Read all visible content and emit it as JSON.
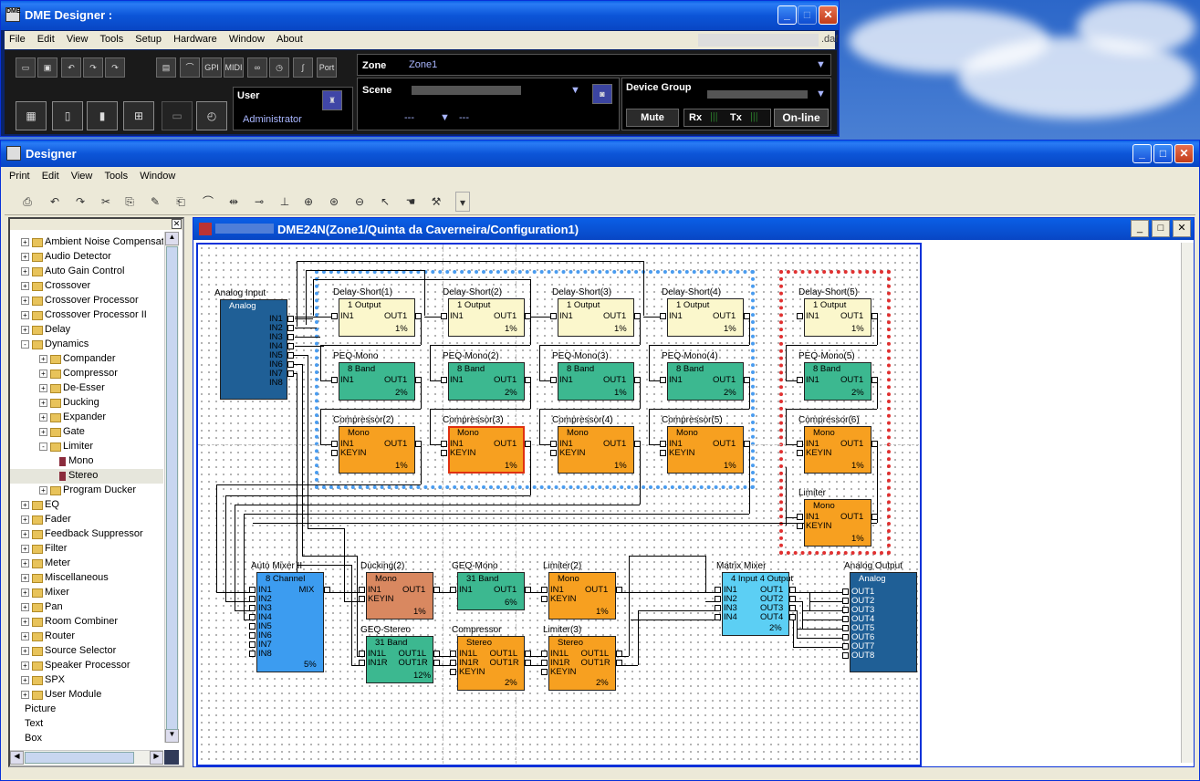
{
  "dme": {
    "title": "DME Designer :",
    "file_suffix": ".daf",
    "menu": [
      "File",
      "Edit",
      "View",
      "Tools",
      "Setup",
      "Hardware",
      "Window",
      "About"
    ],
    "toolbar_icons": [
      "open-icon",
      "save-icon",
      "undo-icon",
      "redo-icon",
      "redo2-icon",
      "meter-icon",
      "graph-icon",
      "gpi-icon",
      "midi-icon",
      "link-icon",
      "clock-icon",
      "wave-icon",
      "port-icon"
    ],
    "small_labels": {
      "gpi": "GPI",
      "midi": "MIDI",
      "port": "Port"
    },
    "user": {
      "label": "User",
      "name": "Administrator"
    },
    "zone": {
      "label": "Zone",
      "value": "Zone1"
    },
    "scene": {
      "label": "Scene",
      "num1": "---",
      "num2": "---"
    },
    "device_group": {
      "label": "Device Group"
    },
    "mute": "Mute",
    "rx": "Rx",
    "tx": "Tx",
    "online": "On-line"
  },
  "designer": {
    "title": "Designer",
    "menu": [
      "Print",
      "Edit",
      "View",
      "Tools",
      "Window"
    ]
  },
  "tree": {
    "items": [
      {
        "label": "Ambient Noise Compensato",
        "level": 0,
        "type": "folder",
        "expander": "+"
      },
      {
        "label": "Audio Detector",
        "level": 0,
        "type": "folder",
        "expander": "+"
      },
      {
        "label": "Auto Gain Control",
        "level": 0,
        "type": "folder",
        "expander": "+"
      },
      {
        "label": "Crossover",
        "level": 0,
        "type": "folder",
        "expander": "+"
      },
      {
        "label": "Crossover Processor",
        "level": 0,
        "type": "folder",
        "expander": "+"
      },
      {
        "label": "Crossover Processor II",
        "level": 0,
        "type": "folder",
        "expander": "+"
      },
      {
        "label": "Delay",
        "level": 0,
        "type": "folder",
        "expander": "+"
      },
      {
        "label": "Dynamics",
        "level": 0,
        "type": "folder",
        "expander": "-"
      },
      {
        "label": "Compander",
        "level": 1,
        "type": "folder",
        "expander": "+"
      },
      {
        "label": "Compressor",
        "level": 1,
        "type": "folder",
        "expander": "+"
      },
      {
        "label": "De-Esser",
        "level": 1,
        "type": "folder",
        "expander": "+"
      },
      {
        "label": "Ducking",
        "level": 1,
        "type": "folder",
        "expander": "+"
      },
      {
        "label": "Expander",
        "level": 1,
        "type": "folder",
        "expander": "+"
      },
      {
        "label": "Gate",
        "level": 1,
        "type": "folder",
        "expander": "+"
      },
      {
        "label": "Limiter",
        "level": 1,
        "type": "folder",
        "expander": "-"
      },
      {
        "label": "Mono",
        "level": 2,
        "type": "leaf",
        "expander": ""
      },
      {
        "label": "Stereo",
        "level": 2,
        "type": "leaf",
        "expander": ""
      },
      {
        "label": "Program Ducker",
        "level": 1,
        "type": "folder",
        "expander": "+"
      },
      {
        "label": "EQ",
        "level": 0,
        "type": "folder",
        "expander": "+"
      },
      {
        "label": "Fader",
        "level": 0,
        "type": "folder",
        "expander": "+"
      },
      {
        "label": "Feedback Suppressor",
        "level": 0,
        "type": "folder",
        "expander": "+"
      },
      {
        "label": "Filter",
        "level": 0,
        "type": "folder",
        "expander": "+"
      },
      {
        "label": "Meter",
        "level": 0,
        "type": "folder",
        "expander": "+"
      },
      {
        "label": "Miscellaneous",
        "level": 0,
        "type": "folder",
        "expander": "+"
      },
      {
        "label": "Mixer",
        "level": 0,
        "type": "folder",
        "expander": "+"
      },
      {
        "label": "Pan",
        "level": 0,
        "type": "folder",
        "expander": "+"
      },
      {
        "label": "Room Combiner",
        "level": 0,
        "type": "folder",
        "expander": "+"
      },
      {
        "label": "Router",
        "level": 0,
        "type": "folder",
        "expander": "+"
      },
      {
        "label": "Source Selector",
        "level": 0,
        "type": "folder",
        "expander": "+"
      },
      {
        "label": "Speaker Processor",
        "level": 0,
        "type": "folder",
        "expander": "+"
      },
      {
        "label": "SPX",
        "level": 0,
        "type": "folder",
        "expander": "+"
      },
      {
        "label": "User Module",
        "level": 0,
        "type": "folder",
        "expander": "+"
      },
      {
        "label": "Picture",
        "level": 0,
        "type": "plain",
        "expander": ""
      },
      {
        "label": "Text",
        "level": 0,
        "type": "plain",
        "expander": ""
      },
      {
        "label": "Box",
        "level": 0,
        "type": "plain",
        "expander": ""
      }
    ]
  },
  "child": {
    "title": "DME24N(Zone1/Quinta da Caverneira/Configuration1)"
  },
  "components": [
    {
      "id": "analog-input",
      "title": "Analog Input",
      "sub": "Analog",
      "color": "#1f5f96",
      "ports_out": [
        "IN1",
        "IN2",
        "IN3",
        "IN4",
        "IN5",
        "IN6",
        "IN7",
        "IN8"
      ]
    },
    {
      "id": "ds1",
      "title": "Delay-Short(1)",
      "sub": "1 Output",
      "in": "IN1",
      "out": "OUT1",
      "pct": "1%"
    },
    {
      "id": "ds2",
      "title": "Delay-Short(2)",
      "sub": "1 Output",
      "in": "IN1",
      "out": "OUT1",
      "pct": "1%"
    },
    {
      "id": "ds3",
      "title": "Delay-Short(3)",
      "sub": "1 Output",
      "in": "IN1",
      "out": "OUT1",
      "pct": "1%"
    },
    {
      "id": "ds4",
      "title": "Delay-Short(4)",
      "sub": "1 Output",
      "in": "IN1",
      "out": "OUT1",
      "pct": "1%"
    },
    {
      "id": "ds5",
      "title": "Delay-Short(5)",
      "sub": "1 Output",
      "in": "IN1",
      "out": "OUT1",
      "pct": "1%"
    },
    {
      "id": "peq1",
      "title": "PEQ-Mono",
      "sub": "8 Band",
      "in": "IN1",
      "out": "OUT1",
      "pct": "2%"
    },
    {
      "id": "peq2",
      "title": "PEQ-Mono(2)",
      "sub": "8 Band",
      "in": "IN1",
      "out": "OUT1",
      "pct": "2%"
    },
    {
      "id": "peq3",
      "title": "PEQ-Mono(3)",
      "sub": "8 Band",
      "in": "IN1",
      "out": "OUT1",
      "pct": "1%"
    },
    {
      "id": "peq4",
      "title": "PEQ-Mono(4)",
      "sub": "8 Band",
      "in": "IN1",
      "out": "OUT1",
      "pct": "2%"
    },
    {
      "id": "peq5",
      "title": "PEQ-Mono(5)",
      "sub": "8 Band",
      "in": "IN1",
      "out": "OUT1",
      "pct": "2%"
    },
    {
      "id": "cmp2",
      "title": "Compressor(2)",
      "sub": "Mono",
      "in": "IN1",
      "key": "KEYIN",
      "out": "OUT1",
      "pct": "1%"
    },
    {
      "id": "cmp3",
      "title": "Compressor(3)",
      "sub": "Mono",
      "in": "IN1",
      "key": "KEYIN",
      "out": "OUT1",
      "pct": "1%"
    },
    {
      "id": "cmp4",
      "title": "Compressor(4)",
      "sub": "Mono",
      "in": "IN1",
      "key": "KEYIN",
      "out": "OUT1",
      "pct": "1%"
    },
    {
      "id": "cmp5",
      "title": "Compressor(5)",
      "sub": "Mono",
      "in": "IN1",
      "key": "KEYIN",
      "out": "OUT1",
      "pct": "1%"
    },
    {
      "id": "cmp6",
      "title": "Compressor(6)",
      "sub": "Mono",
      "in": "IN1",
      "key": "KEYIN",
      "out": "OUT1",
      "pct": "1%"
    },
    {
      "id": "lim1",
      "title": "Limiter",
      "sub": "Mono",
      "in": "IN1",
      "key": "KEYIN",
      "out": "OUT1",
      "pct": "1%"
    },
    {
      "id": "automix",
      "title": "Auto Mixer II",
      "sub": "8 Channel",
      "ins": [
        "IN1",
        "IN2",
        "IN3",
        "IN4",
        "IN5",
        "IN6",
        "IN7",
        "IN8"
      ],
      "out": "MIX",
      "pct": "5%"
    },
    {
      "id": "duck2",
      "title": "Ducking(2)",
      "sub": "Mono",
      "in": "IN1",
      "key": "KEYIN",
      "out": "OUT1",
      "pct": "1%"
    },
    {
      "id": "geqmono",
      "title": "GEQ-Mono",
      "sub": "31 Band",
      "in": "IN1",
      "out": "OUT1",
      "pct": "6%"
    },
    {
      "id": "lim2",
      "title": "Limiter(2)",
      "sub": "Mono",
      "in": "IN1",
      "key": "KEYIN",
      "out": "OUT1",
      "pct": "1%"
    },
    {
      "id": "geqst",
      "title": "GEQ-Stereo",
      "sub": "31 Band",
      "ins": [
        "IN1L",
        "IN1R"
      ],
      "outs": [
        "OUT1L",
        "OUT1R"
      ],
      "pct": "12%"
    },
    {
      "id": "cmpst",
      "title": "Compressor",
      "sub": "Stereo",
      "ins": [
        "IN1L",
        "IN1R",
        "KEYIN"
      ],
      "outs": [
        "OUT1L",
        "OUT1R"
      ],
      "pct": "2%"
    },
    {
      "id": "lim3",
      "title": "Limiter(3)",
      "sub": "Stereo",
      "ins": [
        "IN1L",
        "IN1R",
        "KEYIN"
      ],
      "outs": [
        "OUT1L",
        "OUT1R"
      ],
      "pct": "2%"
    },
    {
      "id": "matrix",
      "title": "Matrix Mixer",
      "sub": "4 Input 4 Output",
      "ins": [
        "IN1",
        "IN2",
        "IN3",
        "IN4"
      ],
      "outs": [
        "OUT1",
        "OUT2",
        "OUT3",
        "OUT4"
      ],
      "pct": "2%"
    },
    {
      "id": "analog-output",
      "title": "Analog Output",
      "sub": "Analog",
      "ins": [
        "OUT1",
        "OUT2",
        "OUT3",
        "OUT4",
        "OUT5",
        "OUT6",
        "OUT7",
        "OUT8"
      ]
    }
  ]
}
